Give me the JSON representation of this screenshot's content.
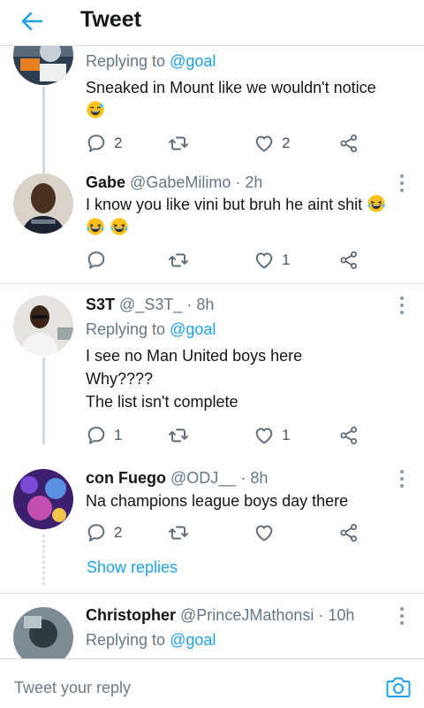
{
  "header": {
    "title": "Tweet"
  },
  "tweets": [
    {
      "reply_prefix": "Replying to",
      "reply_handle": "@goal",
      "text": "Sneaked in Mount like we wouldn't notice",
      "replies": "2",
      "likes": "2"
    },
    {
      "name": "Gabe",
      "handle": "@GabeMilimo",
      "sep": "·",
      "time": "2h",
      "text": "I know you like vini but bruh he aint shit",
      "replies": "",
      "likes": "1"
    },
    {
      "name": "S3T",
      "handle": "@_S3T_",
      "sep": "·",
      "time": "8h",
      "reply_prefix": "Replying to",
      "reply_handle": "@goal",
      "lines": [
        "I see no Man United boys here",
        "Why????",
        "The list isn't complete"
      ],
      "replies": "1",
      "likes": "1"
    },
    {
      "name": "con Fuego",
      "handle": "@ODJ__",
      "sep": "·",
      "time": "8h",
      "text": "Na champions league boys day there",
      "replies": "2",
      "likes": "",
      "show_replies": "Show replies"
    },
    {
      "name": "Christopher",
      "handle": "@PrinceJMathonsi",
      "sep": "·",
      "time": "10h",
      "reply_prefix": "Replying to",
      "reply_handle": "@goal"
    }
  ],
  "composer": {
    "placeholder": "Tweet your reply"
  },
  "icons": {
    "back": "arrow-left-icon",
    "reply": "reply-bubble-icon",
    "retweet": "retweet-icon",
    "like": "heart-icon",
    "share": "share-icon",
    "more": "more-vertical-icon",
    "camera": "camera-icon",
    "emoji_sweat": "grinning-sweat-emoji",
    "emoji_tears": "tears-of-joy-emoji"
  },
  "colors": {
    "accent": "#1da1f2",
    "text": "#14171a",
    "muted": "#657786",
    "thread": "#cfd9de"
  }
}
